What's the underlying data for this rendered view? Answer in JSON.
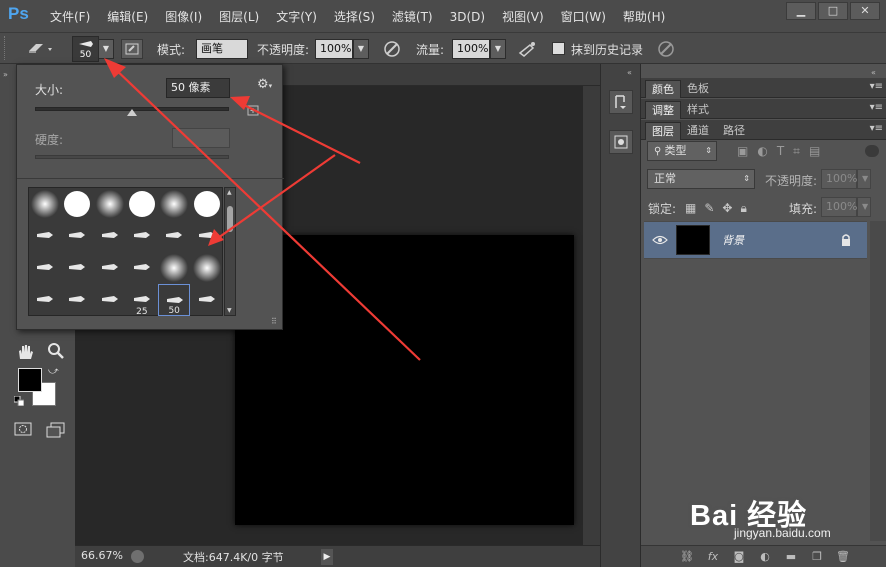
{
  "app": {
    "logo_text": "Ps"
  },
  "menubar": {
    "items": [
      "文件(F)",
      "编辑(E)",
      "图像(I)",
      "图层(L)",
      "文字(Y)",
      "选择(S)",
      "滤镜(T)",
      "3D(D)",
      "视图(V)",
      "窗口(W)",
      "帮助(H)"
    ]
  },
  "window_controls": {
    "minimize": "▁",
    "maximize": "□",
    "close": "✕"
  },
  "options": {
    "brush_size_value": "50",
    "mode_label": "模式:",
    "mode_value": "画笔",
    "opacity_label": "不透明度:",
    "opacity_value": "100%",
    "flow_label": "流量:",
    "flow_value": "100%",
    "history_label": "抹到历史记录"
  },
  "brush_popup": {
    "size_label": "大小:",
    "size_value": "50 像素",
    "size_fraction": 0.5,
    "hardness_label": "硬度:",
    "presets": [
      {
        "kind": "soft"
      },
      {
        "kind": "hard"
      },
      {
        "kind": "soft"
      },
      {
        "kind": "hard"
      },
      {
        "kind": "soft"
      },
      {
        "kind": "hard"
      },
      {
        "kind": "tip"
      },
      {
        "kind": "tip"
      },
      {
        "kind": "tip"
      },
      {
        "kind": "tip"
      },
      {
        "kind": "tip"
      },
      {
        "kind": "tip"
      },
      {
        "kind": "tip"
      },
      {
        "kind": "tip"
      },
      {
        "kind": "tip"
      },
      {
        "kind": "tip"
      },
      {
        "kind": "soft"
      },
      {
        "kind": "soft"
      },
      {
        "kind": "tip"
      },
      {
        "kind": "tip"
      },
      {
        "kind": "tip"
      },
      {
        "kind": "tip",
        "label": "25"
      },
      {
        "kind": "tip",
        "label": "50",
        "selected": true
      },
      {
        "kind": "tip"
      }
    ]
  },
  "panels": {
    "color_tab": "颜色",
    "swatches_tab": "色板",
    "adjust_tab": "调整",
    "styles_tab": "样式",
    "layers_tab": "图层",
    "channels_tab": "通道",
    "paths_tab": "路径",
    "kind_filter": "类型",
    "blend_mode": "正常",
    "opacity_label": "不透明度:",
    "opacity_value": "100%",
    "lock_label": "锁定:",
    "fill_label": "填充:",
    "fill_value": "100%",
    "layer_name": "背景"
  },
  "status": {
    "zoom": "66.67%",
    "doc_info": "文档:647.4K/0 字节"
  },
  "watermark": {
    "brand": "Bai 经验",
    "url": "jingyan.baidu.com"
  },
  "colors": {
    "arrow_red": "#ee3b35",
    "selected_layer": "#5a6e8a",
    "canvas": "#000000"
  }
}
